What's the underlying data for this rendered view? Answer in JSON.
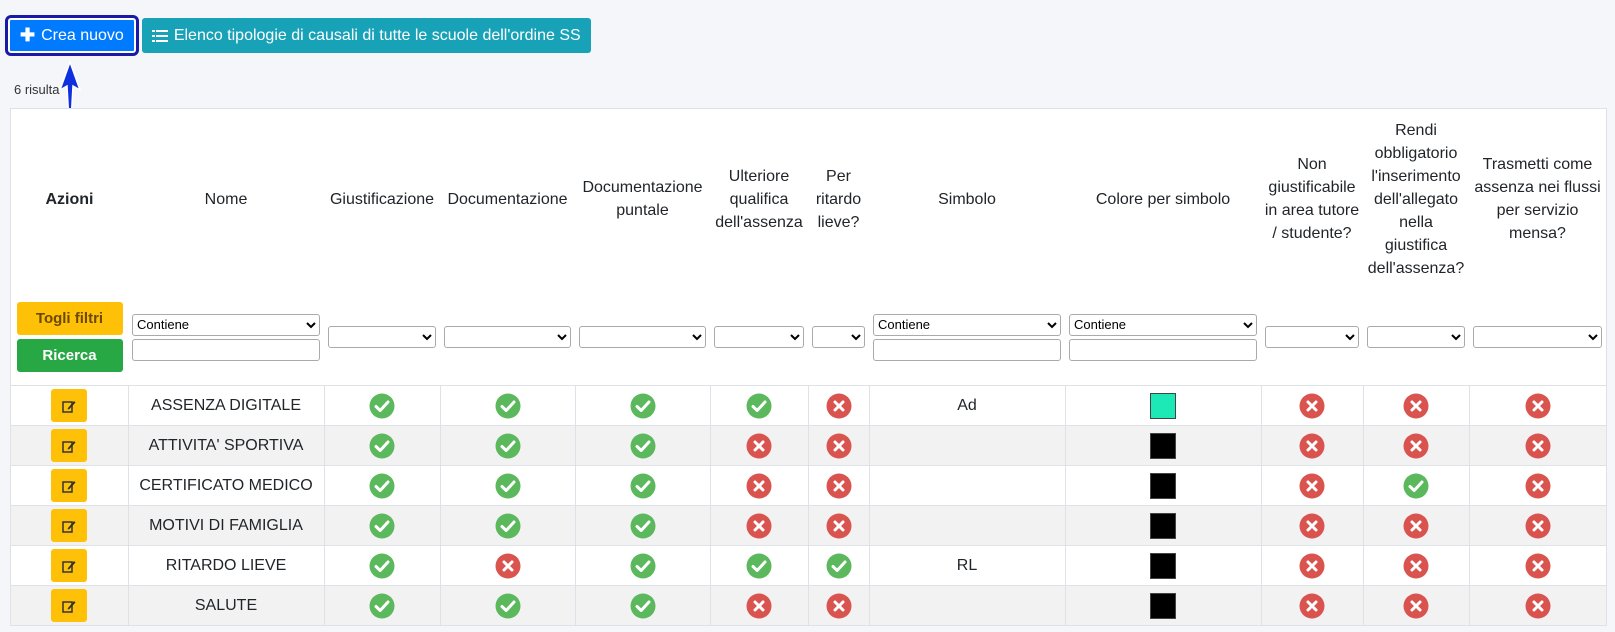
{
  "toolbar": {
    "create_label": "Crea nuovo",
    "list_label": "Elenco tipologie di causali di tutte le scuole dell'ordine SS"
  },
  "results_count": "6 risulta",
  "headers": [
    "Azioni",
    "Nome",
    "Giustificazione",
    "Documentazione",
    "Documentazione puntale",
    "Ulteriore qualifica dell'assenza",
    "Per ritardo lieve?",
    "Simbolo",
    "Colore per simbolo",
    "Non giustificabile in area tutore / studente?",
    "Rendi obbligatorio l'inserimento dell'allegato nella giustifica dell'assenza?",
    "Trasmetti come assenza nei flussi per servizio mensa?"
  ],
  "filters": {
    "clear_label": "Togli filtri",
    "search_label": "Ricerca",
    "contains_option": "Contiene"
  },
  "rows": [
    {
      "name": "ASSENZA DIGITALE",
      "giust": true,
      "doc": true,
      "docp": true,
      "ult": true,
      "rit": false,
      "simbolo": "Ad",
      "colore": "#1de9b6",
      "nongiust": false,
      "allegato": false,
      "mensa": false
    },
    {
      "name": "ATTIVITA' SPORTIVA",
      "giust": true,
      "doc": true,
      "docp": true,
      "ult": false,
      "rit": false,
      "simbolo": "",
      "colore": "#000000",
      "nongiust": false,
      "allegato": false,
      "mensa": false
    },
    {
      "name": "CERTIFICATO MEDICO",
      "giust": true,
      "doc": true,
      "docp": true,
      "ult": false,
      "rit": false,
      "simbolo": "",
      "colore": "#000000",
      "nongiust": false,
      "allegato": true,
      "mensa": false
    },
    {
      "name": "MOTIVI DI FAMIGLIA",
      "giust": true,
      "doc": true,
      "docp": true,
      "ult": false,
      "rit": false,
      "simbolo": "",
      "colore": "#000000",
      "nongiust": false,
      "allegato": false,
      "mensa": false
    },
    {
      "name": "RITARDO LIEVE",
      "giust": true,
      "doc": false,
      "docp": true,
      "ult": true,
      "rit": true,
      "simbolo": "RL",
      "colore": "#000000",
      "nongiust": false,
      "allegato": false,
      "mensa": false
    },
    {
      "name": "SALUTE",
      "giust": true,
      "doc": true,
      "docp": true,
      "ult": false,
      "rit": false,
      "simbolo": "",
      "colore": "#000000",
      "nongiust": false,
      "allegato": false,
      "mensa": false
    }
  ],
  "colors": {
    "check": "#5cb85c",
    "cross": "#d9534f"
  }
}
